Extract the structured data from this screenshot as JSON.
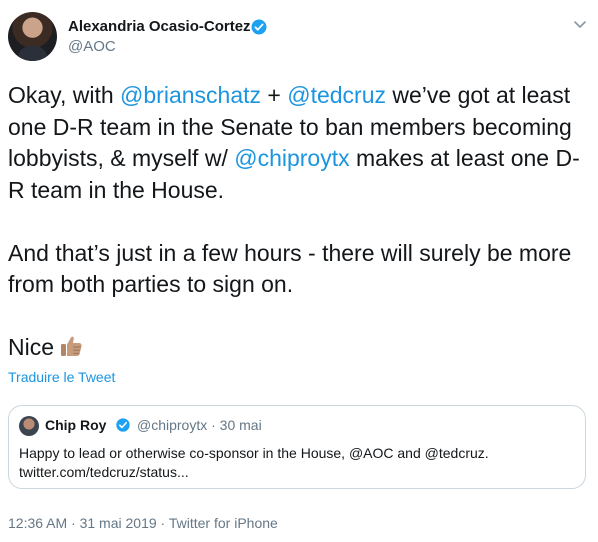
{
  "author": {
    "name": "Alexandria Ocasio-Cortez",
    "handle": "@AOC",
    "icons": {
      "avatar": "profile-photo",
      "verified": "verified-badge-icon",
      "menu": "chevron-down-icon"
    }
  },
  "tweet": {
    "p1_a": "Okay, with ",
    "mention_1": "@brianschatz",
    "p1_b": " + ",
    "mention_2": "@tedcruz",
    "p1_c": " we’ve got at least one D-R team in the Senate to ban members becoming lobbyists, & myself w/ ",
    "mention_3": "@chiproytx",
    "p1_d": " makes at least one D-R team in the House.",
    "p2": "And that’s just in a few hours - there will surely be more from both parties to sign on.",
    "p3": "Nice",
    "emoji": "thumbs-up-medium-skin-tone"
  },
  "translate_label": "Traduire le Tweet",
  "quote": {
    "name": "Chip Roy",
    "meta": "@chiproytx · 30 mai",
    "body_line1": "Happy to lead or otherwise co-sponsor in the House, @AOC and @tedcruz.",
    "body_line2": "twitter.com/tedcruz/status..."
  },
  "footer": {
    "timestamp": "12:36 AM · 31 mai 2019",
    "separator": " · ",
    "source": "Twitter for iPhone"
  },
  "colors": {
    "link": "#1b95e0",
    "text": "#14171a",
    "muted": "#657786",
    "border": "#ccd6dd",
    "verified": "#1da1f2"
  }
}
